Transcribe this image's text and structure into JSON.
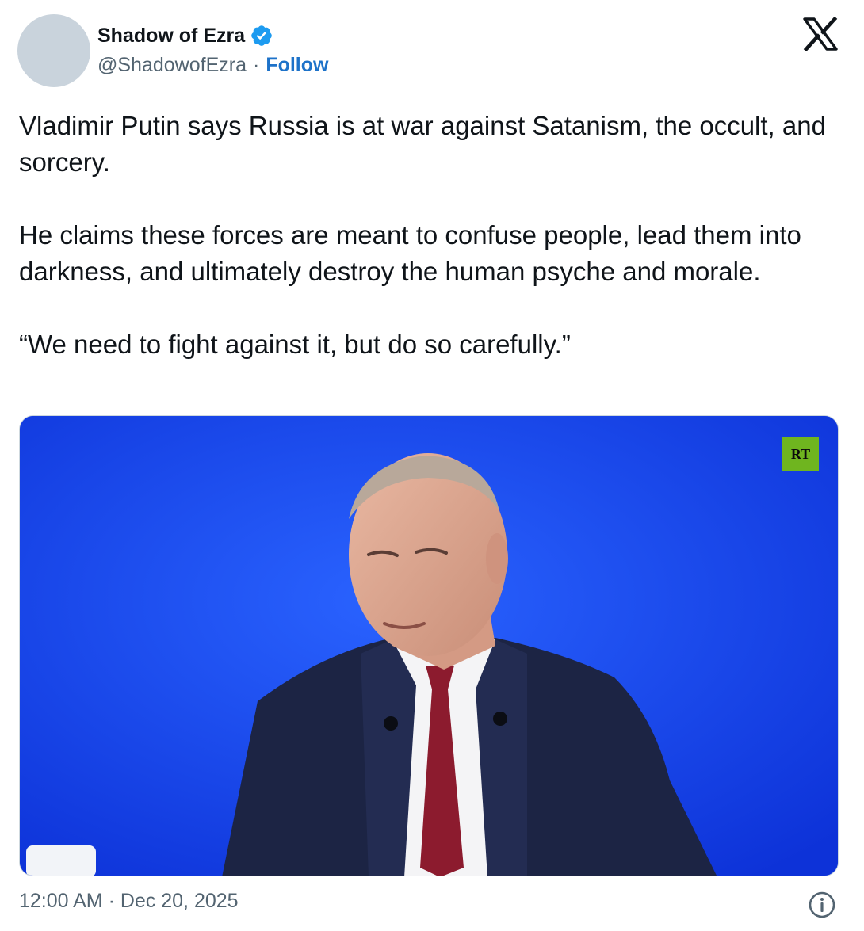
{
  "author": {
    "display_name": "Shadow of Ezra",
    "handle": "@ShadowofEzra",
    "separator": "·",
    "follow_label": "Follow",
    "verified_icon": "verified-badge-icon"
  },
  "platform_icon": "x-logo-icon",
  "tweet": {
    "paragraphs": [
      "Vladimir Putin says Russia is at war against Satanism, the occult, and sorcery.",
      "He claims these forces are meant to confuse people, lead them into darkness, and ultimately destroy the human psyche and morale.",
      "“We need to fight against it, but do so carefully.”"
    ]
  },
  "media": {
    "type": "video-still",
    "channel_logo_text": "RT",
    "background_color": "#1340e6"
  },
  "footer": {
    "timestamp": "12:00 AM · Dec 20, 2025",
    "info_icon": "info-icon"
  },
  "colors": {
    "follow": "#1d72c9",
    "verified": "#1d9bf0",
    "secondary_text": "#536471",
    "rt_logo": "#6fb51f"
  }
}
